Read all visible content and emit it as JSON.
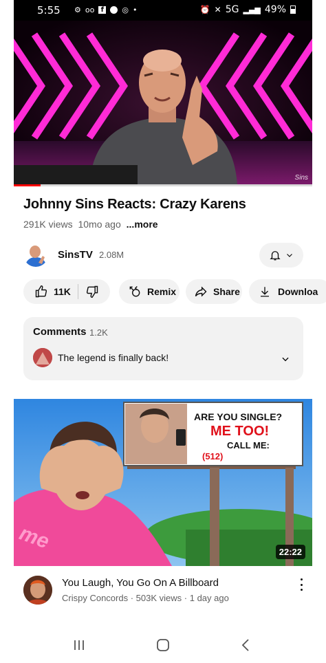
{
  "status_bar": {
    "time": "5:55",
    "network": "5G",
    "battery": "49%"
  },
  "video": {
    "title": "Johnny Sins Reacts:  Crazy Karens",
    "views": "291K views",
    "age": "10mo ago",
    "more": "...more",
    "progress": 0.09,
    "watermark": "Sins"
  },
  "channel": {
    "name": "SinsTV",
    "subscribers": "2.08M",
    "bell_icon": "bell-icon",
    "chevron_icon": "chevron-down-icon"
  },
  "actions": {
    "like_count": "11K",
    "remix": "Remix",
    "share": "Share",
    "download": "Downloa"
  },
  "comments": {
    "label": "Comments",
    "count": "1.2K",
    "top_comment": "The legend is finally back!"
  },
  "next_video": {
    "title": "You Laugh, You Go On A Billboard",
    "channel": "Crispy Concords",
    "views": "503K views",
    "age": "1 day ago",
    "duration": "22:22",
    "billboard_line1": "ARE YOU SINGLE?",
    "billboard_line2": "ME TOO!",
    "billboard_line3": "CALL ME:",
    "billboard_line4": "(512) ",
    "sweater_text": "me"
  },
  "colors": {
    "accent_red": "#ff0000",
    "chip_bg": "#f2f2f2",
    "neon_pink": "#ff2bd6"
  }
}
